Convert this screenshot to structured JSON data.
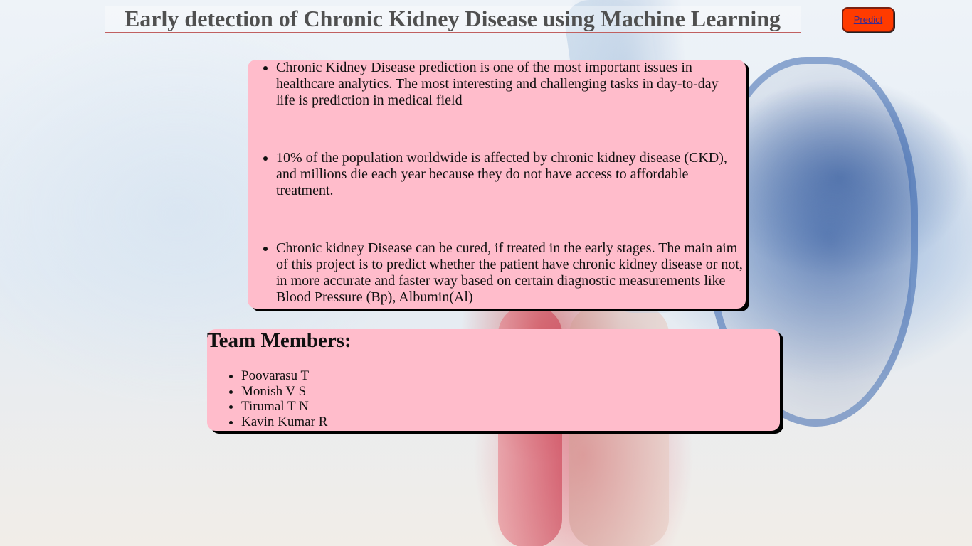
{
  "header": {
    "title": "Early detection of Chronic Kidney Disease using Machine Learning",
    "predict_label": "Predict"
  },
  "info": {
    "points": [
      "Chronic Kidney Disease prediction is one of the most important issues in healthcare analytics. The most interesting and challenging tasks in day-to-day life is prediction in medical field",
      "10% of the population worldwide is affected by chronic kidney disease (CKD), and millions die each year because they do not have access to affordable treatment.",
      "Chronic kidney Disease can be cured, if treated in the early stages. The main aim of this project is to predict whether the patient have chronic kidney disease or not, in more accurate and faster way based on certain diagnostic measurements like Blood Pressure (Bp), Albumin(Al)"
    ]
  },
  "team": {
    "heading": "Team Members:",
    "members": [
      "Poovarasu T",
      "Monish V S",
      "Tirumal T N",
      "Kavin Kumar R"
    ]
  },
  "colors": {
    "card_background": "#ffbccb",
    "predict_button": "#ff3b00",
    "title_text": "#505050"
  }
}
